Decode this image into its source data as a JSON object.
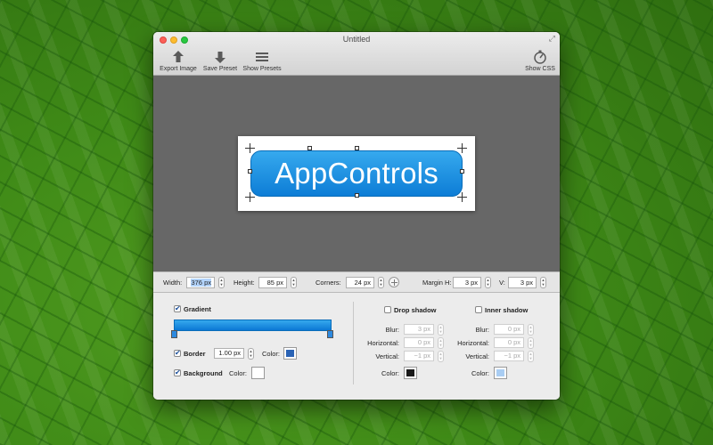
{
  "window": {
    "title": "Untitled"
  },
  "toolbar": {
    "export_label": "Export Image",
    "save_label": "Save Preset",
    "presets_label": "Show Presets",
    "css_label": "Show CSS"
  },
  "preview": {
    "button_text": "AppControls"
  },
  "dimensions": {
    "width_label": "Width:",
    "width_value": "376 px",
    "height_label": "Height:",
    "height_value": "85 px",
    "corners_label": "Corners:",
    "corners_value": "24 px",
    "margin_h_label": "Margin H:",
    "margin_h_value": "3 px",
    "margin_v_label": "V:",
    "margin_v_value": "3 px"
  },
  "style": {
    "gradient": {
      "label": "Gradient",
      "checked": true,
      "color_top": "#36a9ee",
      "color_bottom": "#0b78d4"
    },
    "border": {
      "label": "Border",
      "checked": true,
      "width_value": "1.00 px",
      "color_label": "Color:",
      "color": "#2a63b5"
    },
    "background": {
      "label": "Background",
      "checked": true,
      "color_label": "Color:",
      "color": "#ffffff"
    }
  },
  "drop_shadow": {
    "label": "Drop shadow",
    "checked": false,
    "blur_label": "Blur:",
    "blur_value": "3 px",
    "horizontal_label": "Horizontal:",
    "horizontal_value": "0 px",
    "vertical_label": "Vertical:",
    "vertical_value": "−1 px",
    "color_label": "Color:",
    "color": "#1a1a1a"
  },
  "inner_shadow": {
    "label": "Inner shadow",
    "checked": false,
    "blur_label": "Blur:",
    "blur_value": "0 px",
    "horizontal_label": "Horizontal:",
    "horizontal_value": "0 px",
    "vertical_label": "Vertical:",
    "vertical_value": "−1 px",
    "color_label": "Color:",
    "color": "#a9cdf3"
  },
  "colors": {
    "accent": "#0d7dd6",
    "canvas": "#676767"
  }
}
